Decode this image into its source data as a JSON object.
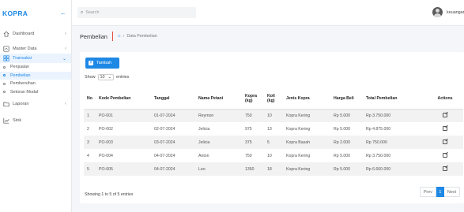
{
  "brand": {
    "name": "KOPRA",
    "back_icon": "arrow-left-icon"
  },
  "sidebar": {
    "items": [
      {
        "label": "Dashboard",
        "icon": "home-icon",
        "chevron": "‹"
      },
      {
        "label": "Master Data",
        "icon": "box-icon",
        "chevron": "‹"
      },
      {
        "label": "Transaksi",
        "icon": "grid-icon",
        "chevron": "⌄",
        "active": true
      },
      {
        "label": "Laporan",
        "icon": "folder-icon",
        "chevron": "‹"
      },
      {
        "label": "Stok",
        "icon": "chart-line-icon",
        "chevron": ""
      }
    ],
    "transaksi_sub": [
      "Penjualan",
      "Pembelian",
      "Pembersihan",
      "Setoran Modal"
    ],
    "selected_sub": "Pembelian"
  },
  "topbar": {
    "search_placeholder": "Search",
    "user_name": "keuangan"
  },
  "page": {
    "title": "Pembelian",
    "breadcrumb": "Data Pembelian"
  },
  "toolbar": {
    "add_label": "Tambah"
  },
  "show": {
    "prefix": "Show",
    "value": "10",
    "suffix": "entries"
  },
  "table": {
    "headers": {
      "no": "No",
      "kode": "Kode Pembelian",
      "tanggal": "Tanggal",
      "nama": "Nama Petani",
      "kopra": "Kopra (kg)",
      "koli": "Koli (kg)",
      "jenis": "Jenis Kopra",
      "harga": "Harga Beli",
      "total": "Total Pembelian",
      "actions": "Actions"
    },
    "rows": [
      {
        "no": "1",
        "kode": "PO-001",
        "tanggal": "01-07-2024",
        "nama": "Reymon",
        "kopra": "750",
        "koli": "10",
        "jenis": "Kopra Kering",
        "harga": "Rp 5.000",
        "total": "Rp 3.750.000"
      },
      {
        "no": "2",
        "kode": "PO-002",
        "tanggal": "02-07-2024",
        "nama": "Jelicia",
        "kopra": "975",
        "koli": "13",
        "jenis": "Kopra Kering",
        "harga": "Rp 5.000",
        "total": "Rp 4.875.000"
      },
      {
        "no": "3",
        "kode": "PO-003",
        "tanggal": "03-07-2024",
        "nama": "Jelicia",
        "kopra": "375",
        "koli": "5",
        "jenis": "Kopra Basah",
        "harga": "Rp 2.000",
        "total": "Rp 750.000"
      },
      {
        "no": "4",
        "kode": "PO-004",
        "tanggal": "04-07-2024",
        "nama": "Anton",
        "kopra": "750",
        "koli": "10",
        "jenis": "Kopra Kering",
        "harga": "Rp 5.000",
        "total": "Rp 3.750.000"
      },
      {
        "no": "5",
        "kode": "PO-005",
        "tanggal": "04-07-2024",
        "nama": "Leo",
        "kopra": "1350",
        "koli": "18",
        "jenis": "Kopra Kering",
        "harga": "Rp 5.000",
        "total": "Rp 6.660.000"
      }
    ]
  },
  "footer": {
    "info": "Showing 1 to 5 of 5 entries",
    "prev": "Prev",
    "current": "1",
    "next": "Next"
  },
  "colors": {
    "accent": "#1e88e5",
    "divider": "#e64a3a"
  }
}
